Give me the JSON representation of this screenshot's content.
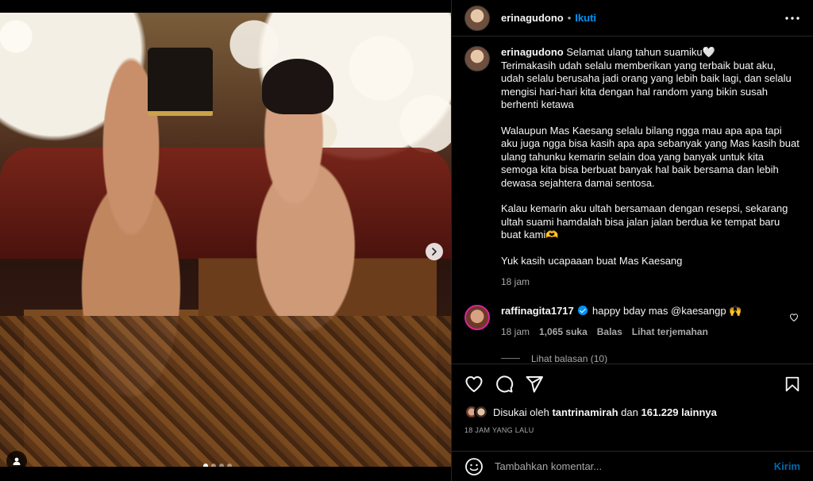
{
  "post": {
    "author": "erinagudono",
    "follow_label": "Ikuti",
    "separator": "•",
    "image_alt": "Foto pasangan dengan busana adat Jawa",
    "carousel_slides": 4,
    "carousel_active": 1
  },
  "caption": {
    "username": "erinagudono",
    "line1": "Selamat ulang tahun suamiku🤍",
    "line2": "Terimakasih udah selalu memberikan yang terbaik buat aku, udah selalu berusaha jadi orang yang lebih baik lagi, dan selalu mengisi hari-hari kita dengan hal random yang bikin susah berhenti ketawa",
    "para2": "Walaupun Mas Kaesang selalu bilang ngga mau apa apa tapi aku juga ngga bisa kasih apa apa sebanyak yang Mas kasih buat ulang tahunku kemarin selain doa yang banyak untuk kita semoga kita bisa berbuat banyak hal baik bersama dan lebih dewasa sejahtera damai sentosa.",
    "para3": "Kalau kemarin aku ultah bersamaan dengan resepsi, sekarang ultah suami hamdalah bisa jalan jalan berdua ke tempat baru buat kami🫶",
    "para4": "Yuk kasih ucapaaan buat Mas Kaesang",
    "time": "18 jam"
  },
  "comment": {
    "username": "raffinagita1717",
    "text": "happy bday mas @kaesangp 🙌",
    "time": "18 jam",
    "likes": "1,065 suka",
    "reply_label": "Balas",
    "translate_label": "Lihat terjemahan",
    "view_replies": "Lihat balasan (10)"
  },
  "likes": {
    "prefix": "Disukai oleh",
    "first_user": "tantrinamirah",
    "connector": "dan",
    "others": "161.229 lainnya"
  },
  "timestamp": "18 JAM YANG LALU",
  "composer": {
    "placeholder": "Tambahkan komentar...",
    "send_label": "Kirim"
  },
  "colors": {
    "accent": "#0095f6",
    "background": "#000000",
    "border": "#262626",
    "muted": "#a8a8a8"
  },
  "icons": [
    "more-icon",
    "heart-icon",
    "comment-icon",
    "share-icon",
    "bookmark-icon",
    "emoji-icon",
    "chevron-right-icon",
    "user-tag-icon",
    "verified-badge-icon"
  ]
}
